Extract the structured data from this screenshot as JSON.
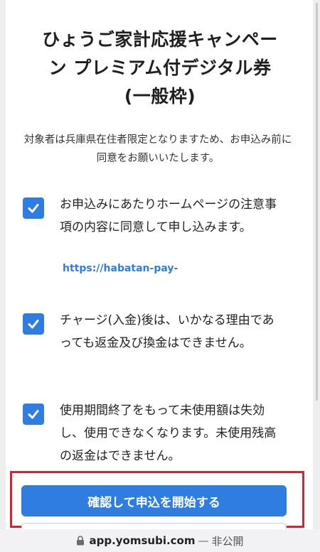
{
  "page": {
    "title_lines": [
      "ひょうご家計応援キャンペー",
      "ン プレミアム付デジタル券",
      "(一般枠)"
    ],
    "notice": "対象者は兵庫県在住者限定となりますため、お申込み前に同意をお願いいたします。"
  },
  "consents": [
    {
      "checked": true,
      "text": "お申込みにあたりホームページの注意事項の内容に同意して申し込みます。",
      "link": "https://habatan-pay-"
    },
    {
      "checked": true,
      "text": "チャージ(入金)後は、いかなる理由であっても返金及び換金はできません。"
    },
    {
      "checked": true,
      "text": "使用期間終了をもって未使用額は失効し、使用できなくなります。未使用残高の返金はできません。"
    }
  ],
  "actions": {
    "submit_label": "確認して申込を開始する"
  },
  "browser": {
    "domain": "app.yomsubi.com",
    "separator": "—",
    "visibility": "非公開",
    "lock_icon": "lock-icon"
  },
  "colors": {
    "accent": "#2f7de1",
    "highlight_border": "#d22630"
  }
}
